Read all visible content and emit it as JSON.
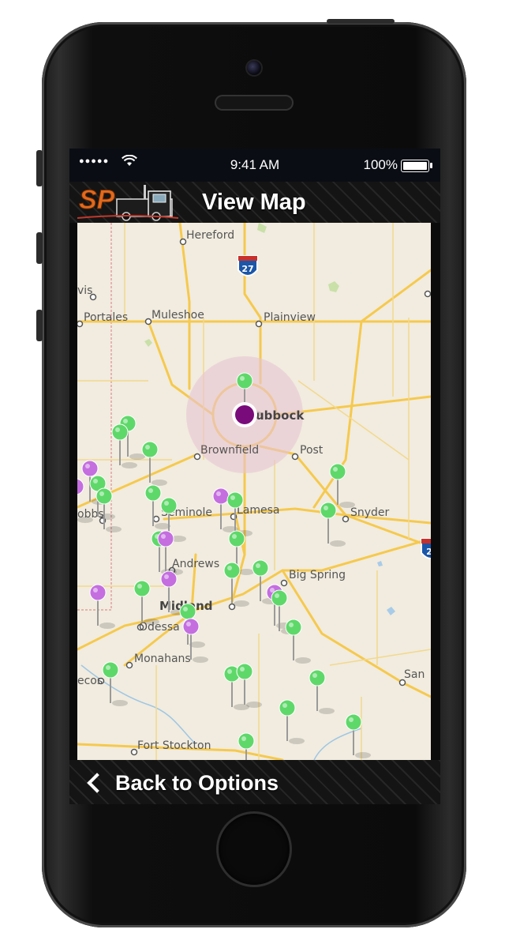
{
  "status_bar": {
    "signal": "●●●●●",
    "time": "9:41 AM",
    "battery": "100%"
  },
  "nav": {
    "logo_text": "SP",
    "title": "View Map"
  },
  "map": {
    "highway_shields": [
      "27",
      "2"
    ],
    "cities": {
      "hereford": "Hereford",
      "vis": "vis",
      "portales": "Portales",
      "muleshoe": "Muleshoe",
      "plainview": "Plainview",
      "lubbock": "ubbock",
      "brownfield": "Brownfield",
      "post": "Post",
      "obbs": "obbs",
      "seminole": "Seminole",
      "lamesa": "Lamesa",
      "snyder": "Snyder",
      "andrews": "Andrews",
      "big_spring": "Big Spring",
      "midland": "Midland",
      "odessa": "Odessa",
      "monahans": "Monahans",
      "pecos": "ecos",
      "san": "San",
      "fort_stockton": "Fort Stockton"
    },
    "pin_colors": {
      "green": "#5fd86a",
      "purple": "#c46ee0",
      "selected": "#7a0b7a",
      "radius": "#e7c5d2"
    }
  },
  "bottom": {
    "back_label": "Back to Options"
  }
}
